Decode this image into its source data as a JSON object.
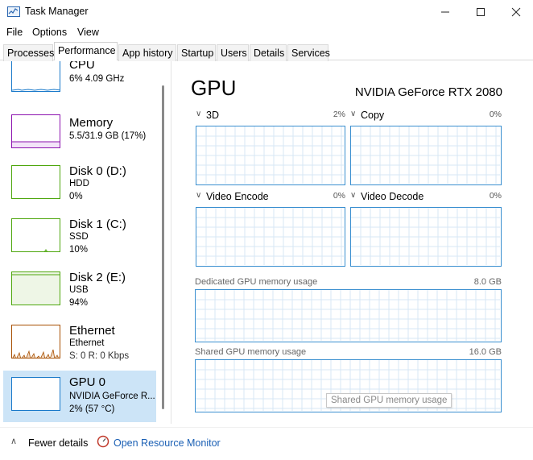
{
  "window": {
    "title": "Task Manager"
  },
  "menu": [
    "File",
    "Options",
    "View"
  ],
  "tabs": [
    {
      "label": "Processes"
    },
    {
      "label": "Performance",
      "active": true
    },
    {
      "label": "App history"
    },
    {
      "label": "Startup"
    },
    {
      "label": "Users"
    },
    {
      "label": "Details"
    },
    {
      "label": "Services"
    }
  ],
  "sidebar": [
    {
      "title": "CPU",
      "lines": [
        "6% 4.09 GHz"
      ],
      "color": "#1979ca"
    },
    {
      "title": "Memory",
      "lines": [
        "5.5/31.9 GB (17%)"
      ],
      "color": "#8b12ae"
    },
    {
      "title": "Disk 0 (D:)",
      "lines": [
        "HDD",
        "0%"
      ],
      "color": "#4da60c"
    },
    {
      "title": "Disk 1 (C:)",
      "lines": [
        "SSD",
        "10%"
      ],
      "color": "#4da60c"
    },
    {
      "title": "Disk 2 (E:)",
      "lines": [
        "USB",
        "94%"
      ],
      "color": "#4da60c"
    },
    {
      "title": "Ethernet",
      "lines": [
        "Ethernet",
        "S: 0 R: 0 Kbps"
      ],
      "color": "#a74f01"
    },
    {
      "title": "GPU 0",
      "lines": [
        "NVIDIA GeForce R...",
        "2% (57 °C)"
      ],
      "color": "#1979ca",
      "selected": true
    }
  ],
  "main": {
    "title": "GPU",
    "model": "NVIDIA GeForce RTX 2080",
    "engines": [
      {
        "name": "3D",
        "percent": "2%"
      },
      {
        "name": "Copy",
        "percent": "0%"
      },
      {
        "name": "Video Encode",
        "percent": "0%"
      },
      {
        "name": "Video Decode",
        "percent": "0%"
      }
    ],
    "dedicated": {
      "label": "Dedicated GPU memory usage",
      "max": "8.0 GB"
    },
    "shared": {
      "label": "Shared GPU memory usage",
      "max": "16.0 GB"
    },
    "tooltip": "Shared GPU memory usage"
  },
  "footer": {
    "fewer_details": "Fewer details",
    "open_resource_monitor": "Open Resource Monitor"
  }
}
